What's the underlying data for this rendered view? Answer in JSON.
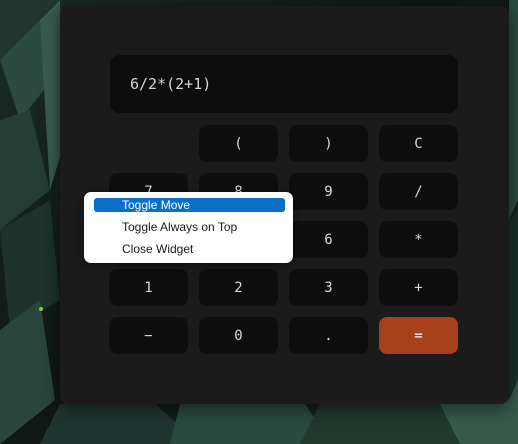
{
  "calculator": {
    "display_text": "6/2*(2+1)",
    "keys": {
      "open_paren": "(",
      "close_paren": ")",
      "clear": "C",
      "seven": "7",
      "eight": "8",
      "nine": "9",
      "divide": "/",
      "six": "6",
      "multiply": "*",
      "one": "1",
      "two": "2",
      "three": "3",
      "plus": "+",
      "minus": "−",
      "zero": "0",
      "decimal": ".",
      "equals": "="
    },
    "accent_color": "#a8401b"
  },
  "context_menu": {
    "items": [
      {
        "label": "Toggle Move",
        "selected": true
      },
      {
        "label": "Toggle Always on Top",
        "selected": false
      },
      {
        "label": "Close Widget",
        "selected": false
      }
    ],
    "highlight_color": "#0a6fc9"
  }
}
